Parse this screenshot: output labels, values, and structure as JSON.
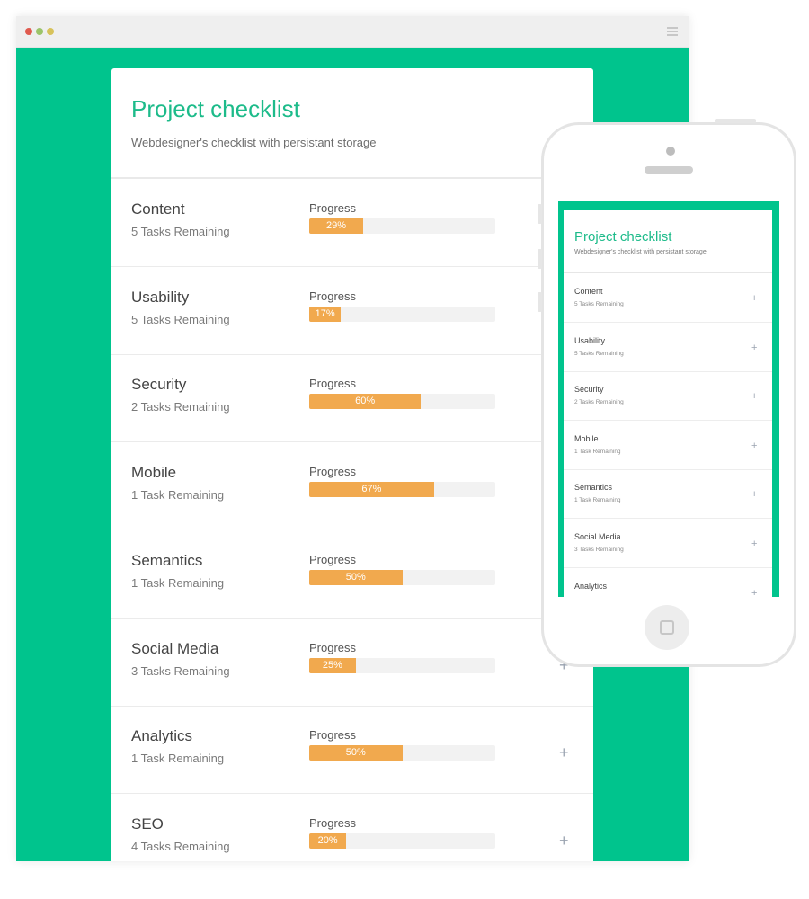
{
  "app": {
    "title": "Project checklist",
    "subtitle": "Webdesigner's checklist with persistant storage",
    "progress_label": "Progress",
    "expand_icon": "+"
  },
  "colors": {
    "accent": "#00c48d",
    "title": "#1dbb8a",
    "progress": "#f1a94e"
  },
  "desktop": {
    "items": [
      {
        "name": "Content",
        "remaining": "5 Tasks Remaining",
        "progress": 29,
        "progress_text": "29%"
      },
      {
        "name": "Usability",
        "remaining": "5 Tasks Remaining",
        "progress": 17,
        "progress_text": "17%"
      },
      {
        "name": "Security",
        "remaining": "2 Tasks Remaining",
        "progress": 60,
        "progress_text": "60%"
      },
      {
        "name": "Mobile",
        "remaining": "1 Task Remaining",
        "progress": 67,
        "progress_text": "67%"
      },
      {
        "name": "Semantics",
        "remaining": "1 Task Remaining",
        "progress": 50,
        "progress_text": "50%"
      },
      {
        "name": "Social Media",
        "remaining": "3 Tasks Remaining",
        "progress": 25,
        "progress_text": "25%"
      },
      {
        "name": "Analytics",
        "remaining": "1 Task Remaining",
        "progress": 50,
        "progress_text": "50%"
      },
      {
        "name": "SEO",
        "remaining": "4 Tasks Remaining",
        "progress": 20,
        "progress_text": "20%"
      }
    ]
  },
  "mobile": {
    "items": [
      {
        "name": "Content",
        "remaining": "5 Tasks Remaining"
      },
      {
        "name": "Usability",
        "remaining": "5 Tasks Remaining"
      },
      {
        "name": "Security",
        "remaining": "2 Tasks Remaining"
      },
      {
        "name": "Mobile",
        "remaining": "1 Task Remaining"
      },
      {
        "name": "Semantics",
        "remaining": "1 Task Remaining"
      },
      {
        "name": "Social Media",
        "remaining": "3 Tasks Remaining"
      },
      {
        "name": "Analytics",
        "remaining": ""
      }
    ]
  }
}
